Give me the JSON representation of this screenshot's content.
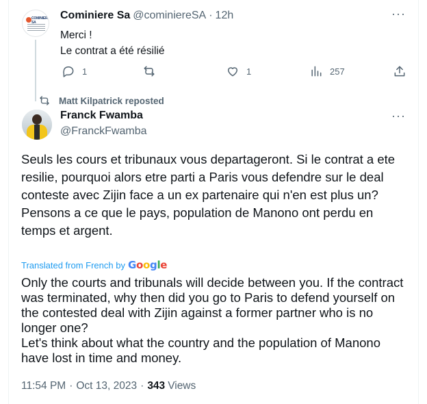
{
  "reply": {
    "name": "Cominiere Sa",
    "handle": "@cominiereSA",
    "separator": "·",
    "time": "12h",
    "text_line1": "Merci !",
    "text_line2": "Le contrat a été résilié",
    "avatar_logo_text": "COMINIERE SA",
    "stats": {
      "replies": "1",
      "likes": "1",
      "views": "257"
    },
    "icons": [
      "reply-icon",
      "retweet-icon",
      "like-icon",
      "views-icon",
      "share-icon",
      "more-icon"
    ]
  },
  "repost_banner": {
    "text": "Matt Kilpatrick reposted",
    "icon": "retweet-icon"
  },
  "tweet": {
    "name": "Franck Fwamba",
    "handle": "@FranckFwamba",
    "original_paragraphs": [
      "Seuls les cours et tribunaux vous departageront. Si le contrat a ete resilie, pourquoi alors etre parti a Paris vous defendre sur le deal conteste avec Zijin face a un ex partenaire qui n'en est plus un?",
      "Pensons a ce que le pays, population de Manono ont perdu en temps et argent."
    ],
    "translated_label": "Translated from French by",
    "translator_logo": "Google",
    "translated_paragraphs": [
      "Only the courts and tribunals will decide between you. If the contract was terminated, why then did you go to Paris to defend yourself on the contested deal with Zijin against a former partner who is no longer one?",
      "Let's think about what the country and the population of Manono have lost in time and money."
    ],
    "time": "11:54 PM",
    "separator": "·",
    "date": "Oct 13, 2023",
    "views_count": "343",
    "views_label": "Views"
  },
  "colors": {
    "text_primary": "#0f1419",
    "text_secondary": "#536471",
    "accent": "#1d9bf0",
    "border": "#eff3f4",
    "thread_line": "#cfd9de"
  }
}
